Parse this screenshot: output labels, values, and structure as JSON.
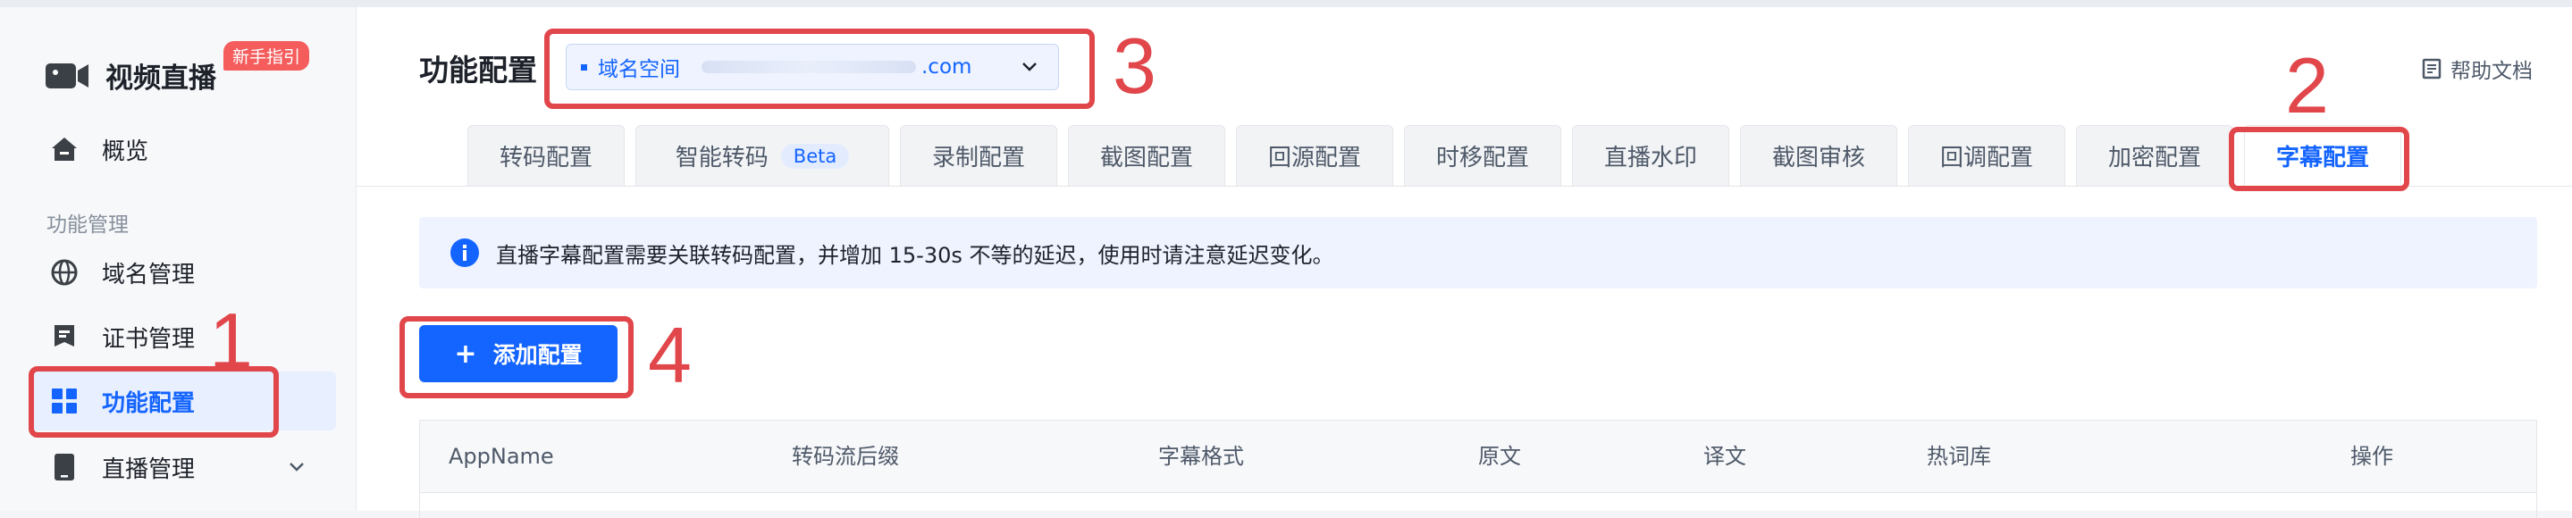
{
  "sidebar": {
    "brand_title": "视频直播",
    "new_badge": "新手指引",
    "group_label": "功能管理",
    "items": [
      {
        "label": "概览",
        "icon": "home-icon"
      },
      {
        "label": "域名管理",
        "icon": "globe-icon"
      },
      {
        "label": "证书管理",
        "icon": "certificate-icon"
      },
      {
        "label": "功能配置",
        "icon": "grid-icon",
        "active": true
      },
      {
        "label": "直播管理",
        "icon": "device-icon"
      }
    ]
  },
  "header": {
    "page_title": "功能配置",
    "domain_select": {
      "label": "域名空间",
      "suffix": ".com"
    },
    "help_label": "帮助文档"
  },
  "tabs": [
    {
      "label": "转码配置"
    },
    {
      "label": "智能转码",
      "badge": "Beta"
    },
    {
      "label": "录制配置"
    },
    {
      "label": "截图配置"
    },
    {
      "label": "回源配置"
    },
    {
      "label": "时移配置"
    },
    {
      "label": "直播水印"
    },
    {
      "label": "截图审核"
    },
    {
      "label": "回调配置"
    },
    {
      "label": "加密配置"
    },
    {
      "label": "字幕配置",
      "active": true
    }
  ],
  "notice": {
    "text": "直播字幕配置需要关联转码配置，并增加 15-30s 不等的延迟，使用时请注意延迟变化。"
  },
  "add_button": {
    "label": "添加配置"
  },
  "table": {
    "columns": [
      "AppName",
      "转码流后缀",
      "字幕格式",
      "原文",
      "译文",
      "热词库",
      "操作"
    ]
  },
  "annotations": [
    "1",
    "2",
    "3",
    "4"
  ],
  "colors": {
    "accent": "#1464ff",
    "annotation": "#e0464a",
    "badge": "#f55d5d"
  }
}
